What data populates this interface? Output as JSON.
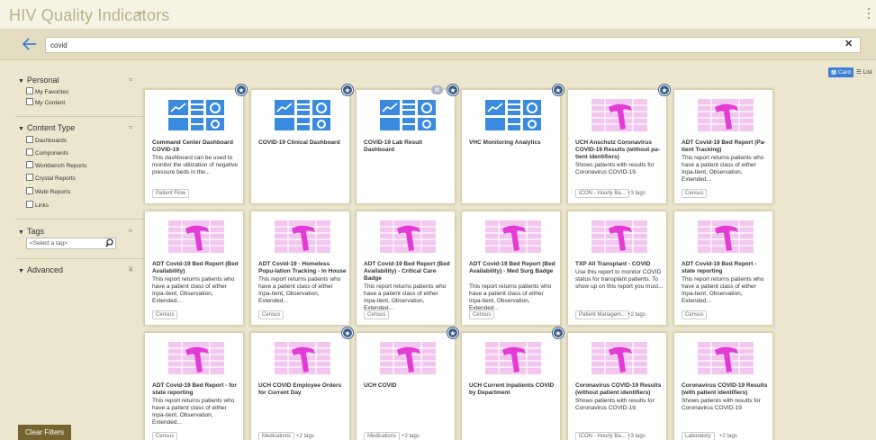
{
  "header": {
    "title": "HIV Quality Indicators"
  },
  "search": {
    "value": "covid"
  },
  "sidebar": {
    "personal": {
      "label": "Personal",
      "items": [
        "My Favorites",
        "My Content"
      ]
    },
    "content_type": {
      "label": "Content Type",
      "items": [
        "Dashboards",
        "Components",
        "Workbench Reports",
        "Crystal Reports",
        "Webi Reports",
        "Links"
      ]
    },
    "tags": {
      "label": "Tags",
      "placeholder": "<Select a tag>"
    },
    "advanced": {
      "label": "Advanced"
    },
    "clear_filters": "Clear Filters"
  },
  "view_toggle": {
    "card": "Card",
    "list": "List"
  },
  "cards": [
    {
      "title": "Command Center Dashboard COVID-19",
      "desc": "This dashboard can be used to monitor the utilization of negative pressure beds in the...",
      "icon": "dashboard-thumbnail-icon",
      "tag": "Patient Flow",
      "more": ""
    },
    {
      "title": "COVID-19 Clinical Dashboard",
      "desc": "",
      "icon": "dashboard-thumbnail-icon",
      "tag": "",
      "more": ""
    },
    {
      "title": "COVID-19 Lab Result Dashboard",
      "desc": "",
      "icon": "dashboard-thumbnail-icon",
      "tag": "",
      "more": ""
    },
    {
      "title": "VHC Monitoring Analytics",
      "desc": "",
      "icon": "dashboard-thumbnail-icon",
      "tag": "",
      "more": ""
    },
    {
      "title": "UCH Anschutz Coronavirus COVID-19 Results (without pa-tient identifiers)",
      "desc": "Shows patients with results for Coronavirus COVID-19.",
      "icon": "report-thumbnail-icon",
      "tag": "ICON - Hourly Ba...",
      "more": "+3 tags"
    },
    {
      "title": "ADT Covid-19 Bed Report (Pa-tient Tracking)",
      "desc": "This report returns patients who have a patient class of either Inpa-tient, Observation, Extended...",
      "icon": "report-thumbnail-icon",
      "tag": "Census",
      "more": ""
    },
    {
      "title": "ADT Covid-19 Bed Report (Bed Availability)",
      "desc": "This report returns patients who have a patient class of either Inpa-tient, Observation, Extended...",
      "icon": "report-thumbnail-icon",
      "tag": "Census",
      "more": ""
    },
    {
      "title": "ADT Covid-19 - Homeless Popu-lation Tracking - In House",
      "desc": "This report returns patients who have a patient class of either Inpa-tient, Observation, Extended...",
      "icon": "report-thumbnail-icon",
      "tag": "Census",
      "more": ""
    },
    {
      "title": "ADT Covid-19 Bed Report (Bed Availability) - Critical Care Badge",
      "desc": "This report returns patients who have a patient class of either Inpa-tient, Observation, Extended...",
      "icon": "report-thumbnail-icon",
      "tag": "Census",
      "more": ""
    },
    {
      "title": "ADT Covid-19 Bed Report (Bed Availability) - Med Surg Badge",
      "desc": "This report returns patients who have a patient class of either Inpa-tient, Observation, Extended...",
      "icon": "report-thumbnail-icon",
      "tag": "Census",
      "more": ""
    },
    {
      "title": "TXP All Transplant - COVID",
      "desc": "Use this report to monitor COVID status for transplant patients. To show up on this report you must...",
      "icon": "report-thumbnail-icon",
      "tag": "Patient Managem...",
      "more": "+2 tags"
    },
    {
      "title": "ADT Covid-19 Bed Report - state reporting",
      "desc": "This report returns patients who have a patient class of either Inpa-tient, Observation, Extended...",
      "icon": "report-thumbnail-icon",
      "tag": "Census",
      "more": ""
    },
    {
      "title": "ADT Covid-19 Bed Report - for state reporting",
      "desc": "This report returns patients who have a patient class of either Inpa-tient, Observation, Extended...",
      "icon": "report-thumbnail-icon",
      "tag": "Census",
      "more": ""
    },
    {
      "title": "UCH COVID Employee Orders for Current Day",
      "desc": "",
      "icon": "report-thumbnail-icon",
      "tag": "Medications",
      "more": "+2 tags"
    },
    {
      "title": "UCH COVID",
      "desc": "",
      "icon": "report-thumbnail-icon",
      "tag": "Medications",
      "more": "+2 tags"
    },
    {
      "title": "UCH Current Inpatients COVID by Department",
      "desc": "",
      "icon": "report-thumbnail-icon",
      "tag": "",
      "more": ""
    },
    {
      "title": "Coronavirus COVID-19 Results (without patient identifiers)",
      "desc": "Shows patients with results for Coronavirus COVID-19.",
      "icon": "report-thumbnail-icon",
      "tag": "ICON - Hourly Ba...",
      "more": "+3 tags"
    },
    {
      "title": "Coronavirus COVID-19 Results (with patient identifiers)",
      "desc": "Shows patients with results for Coronavirus COVID-19.",
      "icon": "report-thumbnail-icon",
      "tag": "Laboratory",
      "more": "+2 tags"
    }
  ],
  "colors": {
    "accent": "#3d7fd6",
    "favorite": "#3a5a86",
    "clear_filters": "#75642e",
    "report_icon": "#e43bd6",
    "dashboard_icon": "#3a8be0"
  }
}
